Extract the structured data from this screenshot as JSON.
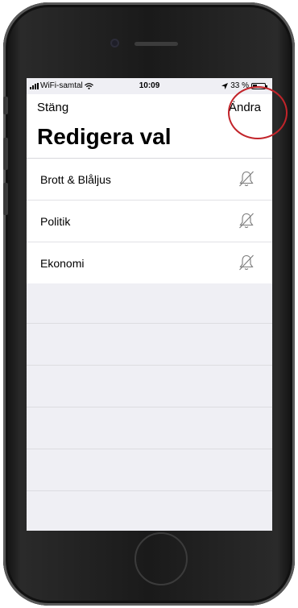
{
  "status_bar": {
    "carrier": "WiFi-samtal",
    "time": "10:09",
    "battery": "33 %",
    "wifi_icon": "wifi-icon",
    "location_icon": "location-arrow-icon"
  },
  "nav": {
    "close_label": "Stäng",
    "edit_label": "Ändra"
  },
  "page": {
    "title": "Redigera val"
  },
  "topics": [
    {
      "label": "Brott & Blåljus",
      "icon": "bell-off-icon"
    },
    {
      "label": "Politik",
      "icon": "bell-off-icon"
    },
    {
      "label": "Ekonomi",
      "icon": "bell-off-icon"
    }
  ],
  "colors": {
    "highlight_ring": "#c2242a",
    "screen_background": "#efeff4"
  }
}
